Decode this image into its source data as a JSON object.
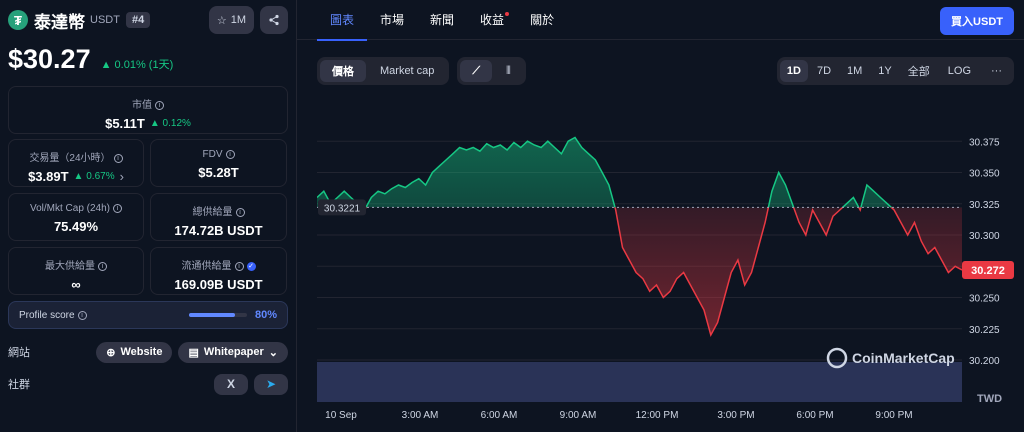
{
  "coin": {
    "logo_letter": "₮",
    "name": "泰達幣",
    "symbol": "USDT",
    "rank": "#4",
    "watch_count": "1M",
    "price": "$30.27",
    "change": "0.01% (1天)"
  },
  "stats": {
    "market_cap": {
      "label": "市值",
      "value": "$5.11T",
      "change": "0.12%"
    },
    "volume": {
      "label": "交易量（24小時）",
      "value": "$3.89T",
      "change": "0.67%"
    },
    "fdv": {
      "label": "FDV",
      "value": "$5.28T"
    },
    "vol_mkt_cap": {
      "label": "Vol/Mkt Cap (24h)",
      "value": "75.49%"
    },
    "total_supply": {
      "label": "總供給量",
      "value": "174.72B USDT"
    },
    "max_supply": {
      "label": "最大供給量",
      "value": "∞"
    },
    "circulating_supply": {
      "label": "流通供給量",
      "value": "169.09B USDT"
    }
  },
  "profile": {
    "label": "Profile score",
    "value": "80%",
    "fraction": 0.8
  },
  "links": {
    "website_label": "網站",
    "website_btn": "Website",
    "whitepaper_btn": "Whitepaper",
    "social_label": "社群",
    "x_icon": "X"
  },
  "tabs": [
    "圖表",
    "市場",
    "新聞",
    "收益",
    "關於"
  ],
  "buy_label": "買入USDT",
  "controls": {
    "price_btn": "價格",
    "mcap_btn": "Market cap",
    "ranges": [
      "1D",
      "7D",
      "1M",
      "1Y",
      "全部"
    ],
    "log": "LOG",
    "more": "···"
  },
  "chart_data": {
    "type": "line",
    "ylim": [
      30.2,
      30.4
    ],
    "yticks": [
      "30.375",
      "30.350",
      "30.325",
      "30.300",
      "30.275",
      "30.250",
      "30.225",
      "30.200"
    ],
    "xticks": [
      "10 Sep",
      "3:00 AM",
      "6:00 AM",
      "9:00 AM",
      "12:00 PM",
      "3:00 PM",
      "6:00 PM",
      "9:00 PM"
    ],
    "baseline": 30.3221,
    "baseline_label": "30.3221",
    "current_label": "30.272",
    "currency_label": "TWD",
    "watermark": "CoinMarketCap",
    "values": [
      30.33,
      30.335,
      30.325,
      30.33,
      30.335,
      30.33,
      30.325,
      30.32,
      30.33,
      30.335,
      30.333,
      30.337,
      30.34,
      30.338,
      30.342,
      30.345,
      30.34,
      30.35,
      30.355,
      30.36,
      30.365,
      30.37,
      30.368,
      30.37,
      30.367,
      30.373,
      30.37,
      30.372,
      30.368,
      30.374,
      30.37,
      30.375,
      30.372,
      30.37,
      30.375,
      30.37,
      30.365,
      30.375,
      30.378,
      30.37,
      30.365,
      30.36,
      30.35,
      30.34,
      30.32,
      30.29,
      30.28,
      30.27,
      30.265,
      30.255,
      30.26,
      30.25,
      30.255,
      30.265,
      30.27,
      30.26,
      30.25,
      30.24,
      30.22,
      30.23,
      30.25,
      30.27,
      30.28,
      30.26,
      30.27,
      30.29,
      30.31,
      30.335,
      30.35,
      30.34,
      30.325,
      30.31,
      30.3,
      30.32,
      30.31,
      30.3,
      30.315,
      30.32,
      30.325,
      30.33,
      30.32,
      30.34,
      30.335,
      30.33,
      30.325,
      30.32,
      30.31,
      30.3,
      30.31,
      30.295,
      30.285,
      30.29,
      30.28,
      30.27,
      30.275,
      30.272
    ]
  }
}
